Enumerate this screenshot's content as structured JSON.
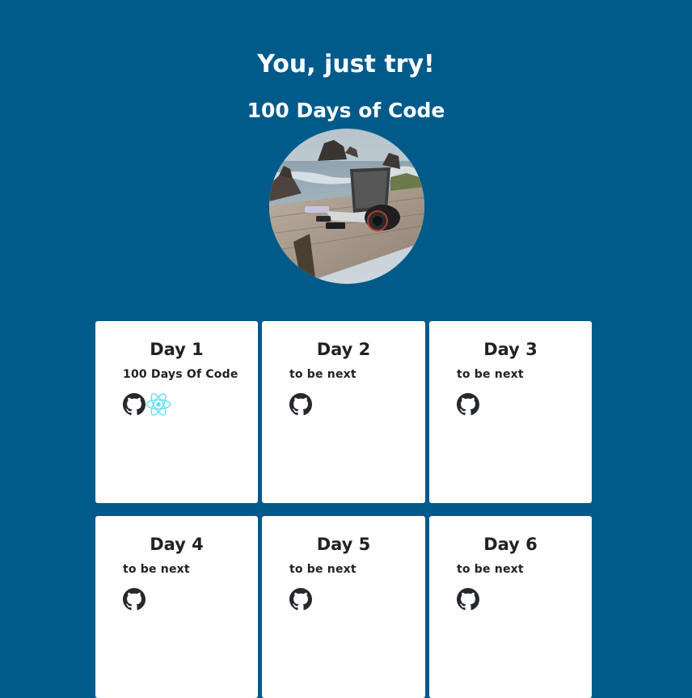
{
  "header": {
    "title": "You, just try!",
    "subtitle": "100 Days of Code"
  },
  "avatar": {
    "icon": "laptop-camera-photo"
  },
  "colors": {
    "background": "#005A8A",
    "card": "#FFFFFF",
    "react": "#61DAFB",
    "github": "#24292E"
  },
  "cards": [
    {
      "title": "Day 1",
      "text": "100 Days Of Code",
      "icons": [
        "github-icon",
        "react-icon"
      ]
    },
    {
      "title": "Day 2",
      "text": "to be next",
      "icons": [
        "github-icon"
      ]
    },
    {
      "title": "Day 3",
      "text": "to be next",
      "icons": [
        "github-icon"
      ]
    },
    {
      "title": "Day 4",
      "text": "to be next",
      "icons": [
        "github-icon"
      ]
    },
    {
      "title": "Day 5",
      "text": "to be next",
      "icons": [
        "github-icon"
      ]
    },
    {
      "title": "Day 6",
      "text": "to be next",
      "icons": [
        "github-icon"
      ]
    }
  ]
}
